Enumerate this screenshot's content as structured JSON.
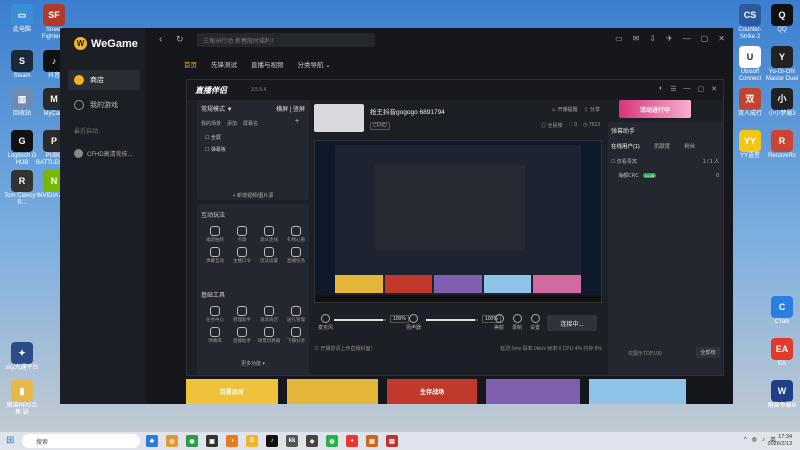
{
  "desktop_icons_left": [
    {
      "label": "此电脑",
      "glyph": "▭",
      "color": "#3a8fd8"
    },
    {
      "label": "Street Fighter V",
      "glyph": "SF",
      "color": "#b23a2a"
    },
    {
      "label": "Steam",
      "glyph": "S",
      "color": "#1b2838"
    },
    {
      "label": "抖音",
      "glyph": "♪",
      "color": "#111"
    },
    {
      "label": "回收站",
      "glyph": "▥",
      "color": "#6d8bb3"
    },
    {
      "label": "MyCard",
      "glyph": "M",
      "color": "#2a2a2a"
    },
    {
      "label": "Logitech G HUB",
      "glyph": "G",
      "color": "#111"
    },
    {
      "label": "PUBG BATTLEGR...",
      "glyph": "P",
      "color": "#2a2a2a"
    },
    {
      "label": "Tom Clancy's R...",
      "glyph": "R",
      "color": "#333"
    },
    {
      "label": "NVIDIA App",
      "glyph": "N",
      "color": "#76b900"
    },
    {
      "label": "sky光遇平台",
      "glyph": "✦",
      "color": "#2b4c8a"
    },
    {
      "label": "魔兽RPG合集 链",
      "glyph": "▮",
      "color": "#e6b84a"
    }
  ],
  "desktop_icons_right": [
    {
      "label": "Counter-Strike 2",
      "glyph": "CS",
      "color": "#2c5aa0"
    },
    {
      "label": "QQ",
      "glyph": "Q",
      "color": "#111"
    },
    {
      "label": "Ubisoft Connect",
      "glyph": "U",
      "color": "#fff"
    },
    {
      "label": "Yu-Gi-Oh! Master Duel",
      "glyph": "Y",
      "color": "#222"
    },
    {
      "label": "双人成行",
      "glyph": "双",
      "color": "#c2442f"
    },
    {
      "label": "小小梦魇3",
      "glyph": "小",
      "color": "#222"
    },
    {
      "label": "YY语音",
      "glyph": "YY",
      "color": "#f5c518"
    },
    {
      "label": "RecoveRx",
      "glyph": "R",
      "color": "#c43"
    },
    {
      "label": "CTalk",
      "glyph": "C",
      "color": "#2a7de1"
    },
    {
      "label": "EA",
      "glyph": "EA",
      "color": "#e03a2a"
    },
    {
      "label": "魔兽争霸III",
      "glyph": "W",
      "color": "#1f3f8a"
    }
  ],
  "wegame": {
    "logo": "WeGame",
    "logo_glyph": "W",
    "nav": [
      {
        "label": "商店",
        "active": true
      },
      {
        "label": "我的游戏",
        "active": false
      }
    ],
    "recent_title": "最近启动",
    "recent_item": "CFHD高清竞技...",
    "search_placeholder": "三角洲行动·新春限时福利！",
    "back_glyph": "‹",
    "refresh_glyph": "↻",
    "top_icons": [
      "▭",
      "✉",
      "⇩",
      "✈",
      "—",
      "▢",
      "✕"
    ],
    "tabs": [
      {
        "label": "首页",
        "on": true
      },
      {
        "label": "先锋测试",
        "on": false
      },
      {
        "label": "直播与视频",
        "on": false
      },
      {
        "label": "分类导航 ⌄",
        "on": false
      }
    ],
    "banners": [
      {
        "label": "百星派对",
        "color": "#f0c23c"
      },
      {
        "label": "",
        "color": "#e3b63a"
      },
      {
        "label": "生存战场",
        "color": "#c0392b"
      },
      {
        "label": "",
        "color": "#7f5fb0"
      },
      {
        "label": "",
        "color": "#8fc3e8"
      }
    ]
  },
  "live": {
    "logo": "直播伴侣",
    "version": "3.5.5.4",
    "head_icons": [
      "◐",
      "☰",
      "—",
      "▢",
      "✕"
    ],
    "banner": "活动进行中",
    "scene_mode": "常规模式 ▼",
    "scene_toggle": "横屏 | 竖屏",
    "scene_tabs": [
      "我的场景",
      "添加",
      "屏幕名"
    ],
    "scene_items": [
      "☐ 全屏",
      "☐ 弹幕板"
    ],
    "add_scene": "+ 新增视频/图片源",
    "interact_title": "互动玩法",
    "interact_tools": [
      "福袋抽奖",
      "点歌",
      "观众连线",
      "礼物心愿",
      "弹幕互动",
      "主播口令",
      "玩法设置",
      "直播任务"
    ],
    "basic_title": "基础工具",
    "basic_tools": [
      "任务中心",
      "管理助手",
      "道具商店",
      "送礼管理",
      "弹幕库",
      "直播助手",
      "场景切换器",
      "下播分享"
    ],
    "more": "更多功能 ▾",
    "room_title": "抢王抖音gogogo 6891794",
    "room_chip": "CFHD",
    "top_right": [
      "☺ 开播提醒",
      "⇧ 分享"
    ],
    "stats": [
      "◎ 全民榜",
      "♡ 0",
      "◷ 7913"
    ],
    "volume_left": "100%",
    "volume_right": "100%",
    "volume_left_level": 0.95,
    "volume_right_level": 0.95,
    "ctl_labels": [
      "麦克风",
      "扬声器",
      "美颜",
      "录制",
      "设置"
    ],
    "start_button": "连接中...",
    "bottom_left": "⊙ 开播前请上传直播封面！",
    "bottom_right": "延迟:0ms  码率:0kb/s  帧率:0  CPU:4%  内存:8%",
    "right_title": "弹幕助手",
    "right_tabs": [
      {
        "label": "在线用户(1)",
        "on": true
      },
      {
        "label": "贡献度",
        "on": false
      },
      {
        "label": "粉丝",
        "on": false
      }
    ],
    "filter_left": "☐ 仅看贵宾",
    "filter_right": "1 / 1 人",
    "user_name": "海都CRC",
    "user_badge": "Lv.26",
    "user_score": "0",
    "rank_text": "仅展示TOP100",
    "rank_btn": "全部榜"
  },
  "taskbar": {
    "start_glyph": "⊞",
    "search_placeholder": "搜索",
    "apps": [
      {
        "glyph": "❖",
        "color": "#2d7be0"
      },
      {
        "glyph": "◎",
        "color": "#d93"
      },
      {
        "glyph": "◉",
        "color": "#2a9d4a"
      },
      {
        "glyph": "▣",
        "color": "#333"
      },
      {
        "glyph": "◑",
        "color": "#e87a1f"
      },
      {
        "glyph": "G",
        "color": "#f0b429"
      },
      {
        "glyph": "♪",
        "color": "#111"
      },
      {
        "glyph": "kk",
        "color": "#555"
      },
      {
        "glyph": "◈",
        "color": "#444"
      },
      {
        "glyph": "◍",
        "color": "#2ab04a"
      },
      {
        "glyph": "◕",
        "color": "#e33"
      },
      {
        "glyph": "▤",
        "color": "#c62"
      },
      {
        "glyph": "▥",
        "color": "#b33"
      }
    ],
    "tray": [
      "^",
      "◍",
      "♪",
      "英"
    ],
    "time": "17:34",
    "date": "2026/2/13"
  }
}
